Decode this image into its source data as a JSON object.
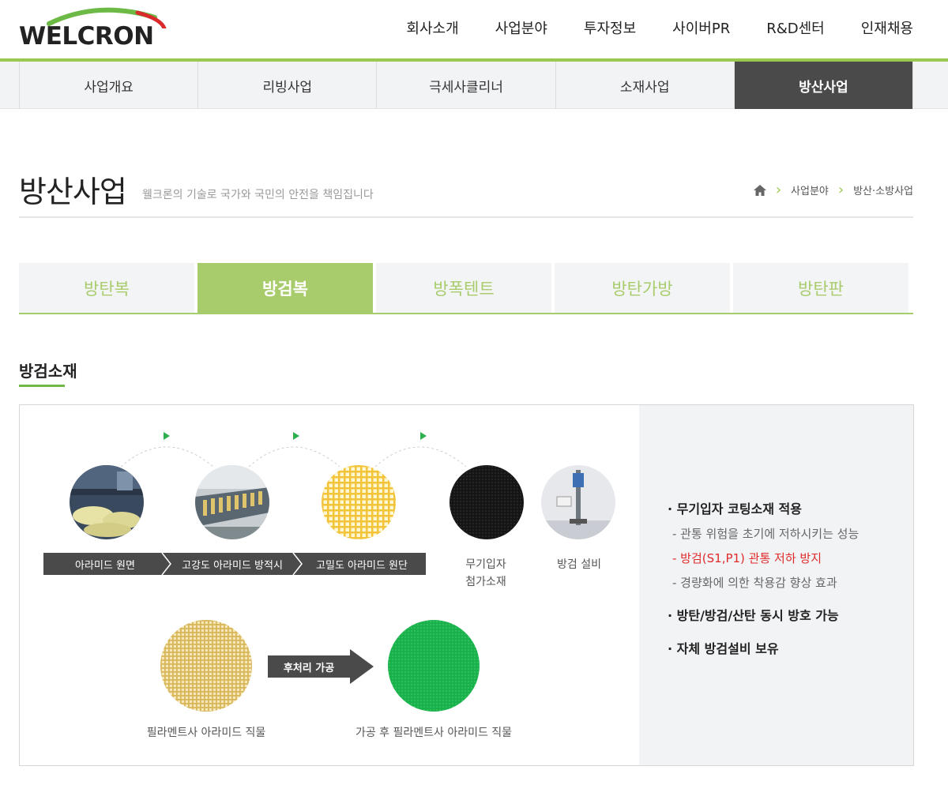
{
  "brand": {
    "logo_text": "WELCRON"
  },
  "gnb": [
    "회사소개",
    "사업분야",
    "투자정보",
    "사이버PR",
    "R&D센터",
    "인재채용"
  ],
  "subnav": [
    "사업개요",
    "리빙사업",
    "극세사클리너",
    "소재사업",
    "방산사업"
  ],
  "page": {
    "title": "방산사업",
    "subtitle": "웰크론의 기술로 국가와 국민의 안전을 책임집니다"
  },
  "breadcrumb": [
    "사업분야",
    "방산·소방사업"
  ],
  "product_tabs": [
    "방탄복",
    "방검복",
    "방폭텐트",
    "방탄가방",
    "방탄판"
  ],
  "section": {
    "title": "방검소재"
  },
  "process": {
    "steps": [
      "아라미드 원면",
      "고강도 아라미드 방적시",
      "고밀도 아라미드 원단"
    ],
    "coating_label_1": "무기입자",
    "coating_label_2": "첨가소재",
    "equipment_label": "방검 설비",
    "post_process": "후처리 가공",
    "before_label": "필라멘트사 아라미드 직물",
    "after_label": "가공 후 필라멘트사 아라미드 직물"
  },
  "features": {
    "p1": "· 무기입자 코팅소재 적용",
    "p1_sub1": "- 관통 위험을 초기에 저하시키는 성능",
    "p1_sub2": "- 방검(S1,P1) 관통 저하 방지",
    "p1_sub3": "- 경량화에 의한 착용감 향상 효과",
    "p2": "· 방탄/방검/산탄 동시 방호 가능",
    "p3": "· 자체 방검설비 보유"
  },
  "colors": {
    "accent": "#9bc94f",
    "tab_green": "#a8cc6b",
    "dark": "#4a4a4a",
    "red": "#e02b2b",
    "green_fabric": "#19b14b"
  }
}
